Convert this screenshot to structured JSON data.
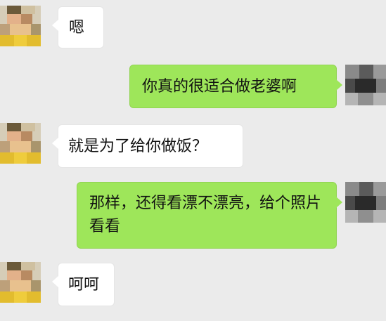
{
  "messages": [
    {
      "side": "in",
      "text": "嗯"
    },
    {
      "side": "out",
      "text": "你真的很适合做老婆啊"
    },
    {
      "side": "in",
      "text": "就是为了给你做饭？"
    },
    {
      "side": "out",
      "text": "那样，还得看漂不漂亮，给个照片看看"
    },
    {
      "side": "in",
      "text": "呵呵"
    }
  ],
  "colors": {
    "background": "#ebebeb",
    "incoming_bubble": "#ffffff",
    "outgoing_bubble": "#9ee65a"
  }
}
